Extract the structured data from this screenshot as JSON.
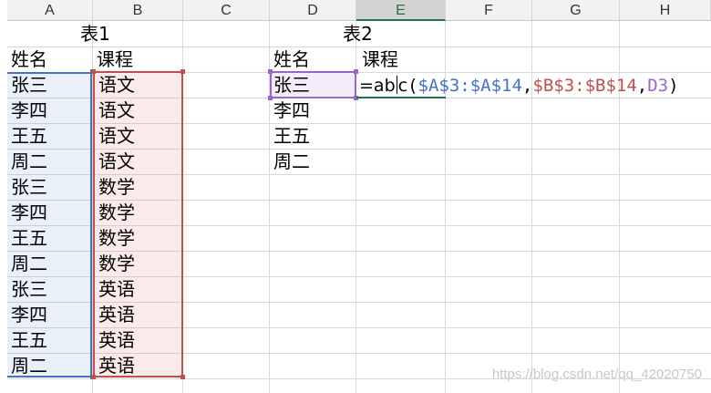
{
  "columns": [
    "A",
    "B",
    "C",
    "D",
    "E",
    "F",
    "G",
    "H"
  ],
  "active_column": "E",
  "colors": {
    "range_a": "#4472c4",
    "range_b": "#c0504d",
    "range_d": "#9966cc",
    "active_green": "#217346"
  },
  "table1": {
    "title": "表1",
    "header_name": "姓名",
    "header_course": "课程",
    "names": [
      "张三",
      "李四",
      "王五",
      "周二",
      "张三",
      "李四",
      "王五",
      "周二",
      "张三",
      "李四",
      "王五",
      "周二"
    ],
    "courses": [
      "语文",
      "语文",
      "语文",
      "语文",
      "数学",
      "数学",
      "数学",
      "数学",
      "英语",
      "英语",
      "英语",
      "英语"
    ]
  },
  "table2": {
    "title": "表2",
    "header_name": "姓名",
    "header_course": "课程",
    "names": [
      "张三",
      "李四",
      "王五",
      "周二"
    ]
  },
  "formula": {
    "lead_a": "=ab",
    "lead_b": "c",
    "open": "(",
    "arg1": "$A$3:$A$14",
    "sep1": ",",
    "arg2": "$B$3:$B$14",
    "sep2": ",",
    "arg3": "D3",
    "close": ")"
  },
  "watermark": "https://blog.csdn.net/qq_42020750"
}
